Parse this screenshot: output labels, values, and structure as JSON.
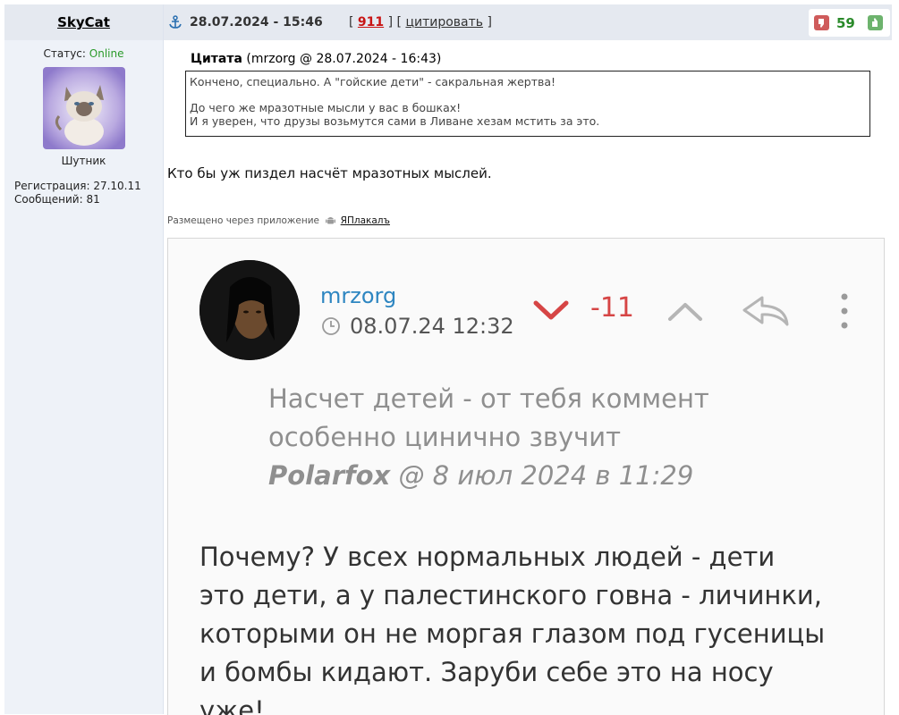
{
  "user": {
    "name": "SkyCat",
    "status_label": "Статус:",
    "status_value": "Online",
    "rank": "Шутник",
    "registration": "Регистрация: 27.10.11",
    "messages": "Сообщений: 81"
  },
  "post": {
    "date": "28.07.2024 - 15:46",
    "number": "911",
    "cite_label": "цитировать",
    "rating": "59",
    "quote_label": "Цитата",
    "quote_source": "(mrzorg @ 28.07.2024 - 16:43)",
    "quote_lines": [
      "Кончено, специально. А \"гойские дети\" - сакральная жертва!",
      "До чего же мразотные мысли у вас в бошках!",
      "И я уверен, что друзы возьмутся сами в Ливане хезам мстить за это."
    ],
    "text": "Кто бы уж пиздел насчёт мразотных мыслей.",
    "app_prefix": "Размещено через приложение",
    "app_name": "ЯПлакалъ"
  },
  "embed": {
    "username": "mrzorg",
    "time": "08.07.24 12:32",
    "score": "-11",
    "quote_lines": [
      "Насчет детей - от тебя коммент",
      "особенно цинично звучит"
    ],
    "quote_author": "Polarfox",
    "quote_meta": "@ 8 июл 2024 в 11:29",
    "body_lines": [
      "Почему? У всех нормальных людей - дети",
      "это дети, а у палестинского говна - личинки,",
      "которыми он не моргая глазом под гусеницы",
      "и бомбы кидают. Заруби себе это на носу",
      "уже!"
    ]
  },
  "colors": {
    "header_bg": "#e5e9f0",
    "sidebar_bg": "#eef2f8",
    "online": "#2a9a2a",
    "post_number": "#c81414",
    "rating": "#2a8a2a",
    "embed_user": "#2e86c1",
    "embed_score": "#d64545"
  },
  "icons": {
    "anchor": "anchor-icon",
    "vote_down": "thumb-down-icon",
    "vote_up": "thumb-up-icon",
    "android": "android-icon",
    "clock": "clock-icon",
    "down": "chevron-down-icon",
    "up": "chevron-up-icon",
    "reply": "reply-arrow-icon",
    "more": "more-vertical-icon"
  }
}
